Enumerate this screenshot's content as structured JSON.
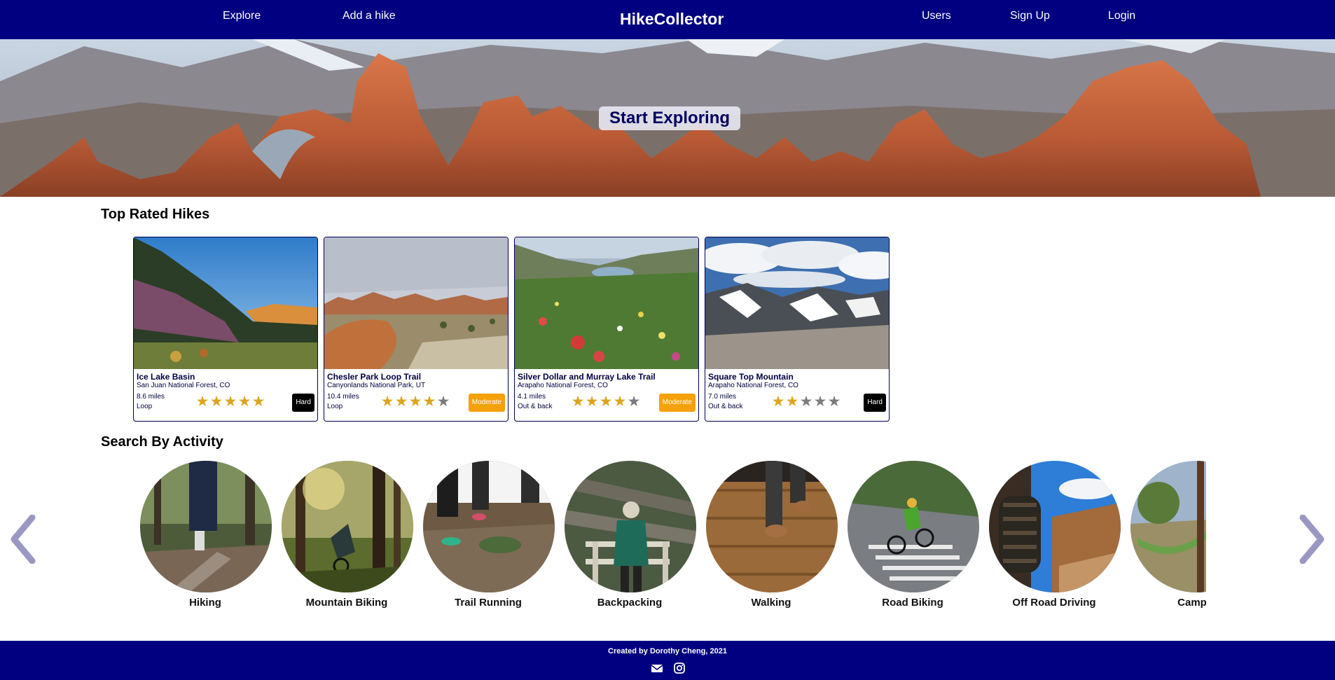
{
  "nav": {
    "explore": "Explore",
    "add_hike": "Add a hike",
    "brand": "HikeCollector",
    "users": "Users",
    "signup": "Sign Up",
    "login": "Login"
  },
  "hero": {
    "title": "Start Exploring"
  },
  "sections": {
    "top_rated": "Top Rated Hikes",
    "by_activity": "Search By Activity"
  },
  "hikes": [
    {
      "name": "Ice Lake Basin",
      "location": "San Juan National Forest, CO",
      "distance": "8.6 miles",
      "route_type": "Loop",
      "rating": 5,
      "difficulty": "Hard",
      "difficulty_color": "#000000"
    },
    {
      "name": "Chesler Park Loop Trail",
      "location": "Canyonlands National Park, UT",
      "distance": "10.4 miles",
      "route_type": "Loop",
      "rating": 4,
      "difficulty": "Moderate",
      "difficulty_color": "#f5a10a"
    },
    {
      "name": "Silver Dollar and Murray Lake Trail",
      "location": "Arapaho National Forest, CO",
      "distance": "4.1 miles",
      "route_type": "Out & back",
      "rating": 4,
      "difficulty": "Moderate",
      "difficulty_color": "#f5a10a"
    },
    {
      "name": "Square Top Mountain",
      "location": "Arapaho National Forest, CO",
      "distance": "7.0 miles",
      "route_type": "Out & back",
      "rating": 2,
      "difficulty": "Hard",
      "difficulty_color": "#000000"
    }
  ],
  "activities": [
    {
      "label": "Hiking"
    },
    {
      "label": "Mountain Biking"
    },
    {
      "label": "Trail Running"
    },
    {
      "label": "Backpacking"
    },
    {
      "label": "Walking"
    },
    {
      "label": "Road Biking"
    },
    {
      "label": "Off Road Driving"
    },
    {
      "label": "Campir"
    }
  ],
  "carousel": {
    "prev_icon": "chevron-left-icon",
    "next_icon": "chevron-right-icon"
  },
  "footer": {
    "credit": "Created by Dorothy Cheng, 2021",
    "icons": [
      "envelope-icon",
      "instagram-icon"
    ]
  },
  "colors": {
    "navy": "#000080",
    "star_on": "#daa520",
    "star_off": "#7c7c7c",
    "moderate": "#f5a10a",
    "hard": "#000000",
    "arrow": "#9a98c2"
  }
}
